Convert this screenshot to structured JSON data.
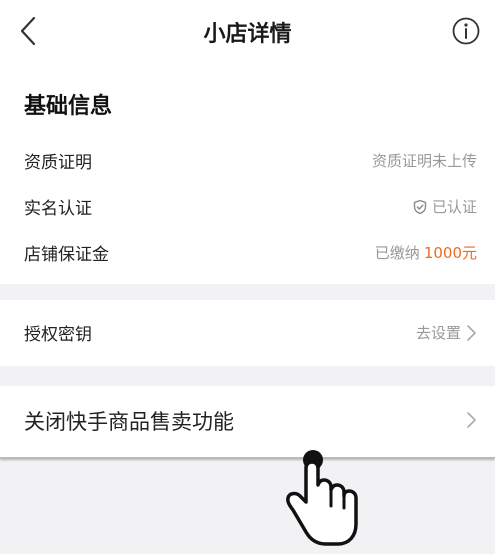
{
  "header": {
    "title": "小店详情",
    "back_icon": "chevron-left-icon",
    "info_icon": "info-circle-icon"
  },
  "basic_info": {
    "title": "基础信息",
    "rows": [
      {
        "label": "资质证明",
        "value": "资质证明未上传"
      },
      {
        "label": "实名认证",
        "value": "已认证",
        "icon": "shield-check-icon"
      },
      {
        "label": "店铺保证金",
        "value": "已缴纳",
        "amount": "1000元"
      }
    ]
  },
  "auth_key": {
    "label": "授权密钥",
    "action": "去设置"
  },
  "close_feature": {
    "label": "关闭快手商品售卖功能"
  },
  "colors": {
    "accent": "#ef6a1f",
    "muted": "#999999",
    "background": "#f2f2f4"
  },
  "overlay": {
    "icon": "tap-hand-icon"
  }
}
